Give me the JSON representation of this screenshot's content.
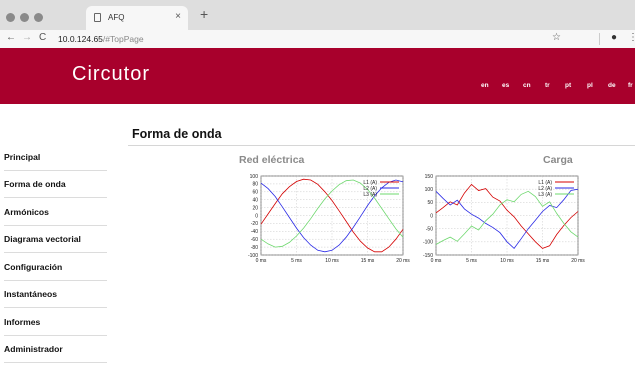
{
  "browser": {
    "tab_title": "AFQ",
    "url_host": "10.0.124.65",
    "url_path": "/#TopPage"
  },
  "header": {
    "logo": "Circutor",
    "languages": [
      "en",
      "es",
      "cn",
      "tr",
      "pt",
      "pl",
      "de",
      "fr"
    ]
  },
  "page": {
    "title": "Forma de onda"
  },
  "sidebar": {
    "items": [
      {
        "label": "Principal"
      },
      {
        "label": "Forma de onda"
      },
      {
        "label": "Armónicos"
      },
      {
        "label": "Diagrama vectorial"
      },
      {
        "label": "Configuración"
      },
      {
        "label": "Instantáneos"
      },
      {
        "label": "Informes"
      },
      {
        "label": "Administrador"
      }
    ]
  },
  "sections": {
    "left_title": "Red eléctrica",
    "right_title": "Carga"
  },
  "colors": {
    "header": "#a8002c",
    "L1": "#d40000",
    "L2": "#2a2ae6",
    "L3": "#6ed86e"
  },
  "chart_data": [
    {
      "type": "line",
      "title": "Red eléctrica",
      "xlabel": "",
      "ylabel": "",
      "xlim": [
        0,
        20
      ],
      "ylim": [
        -100,
        100
      ],
      "x_ticks": [
        "0 ms",
        "5 ms",
        "10 ms",
        "15 ms",
        "20 ms"
      ],
      "y_ticks": [
        "100",
        "80",
        "60",
        "40",
        "20",
        "0",
        "-20",
        "-40",
        "-60",
        "-80",
        "-100"
      ],
      "grid": true,
      "legend": "top-right",
      "x": [
        0,
        1,
        2,
        3,
        4,
        5,
        6,
        7,
        8,
        9,
        10,
        11,
        12,
        13,
        14,
        15,
        16,
        17,
        18,
        19,
        20
      ],
      "series": [
        {
          "name": "L1 (A)",
          "values": [
            -22,
            4,
            30,
            55,
            73,
            86,
            92,
            90,
            79,
            60,
            38,
            12,
            -15,
            -42,
            -65,
            -82,
            -92,
            -92,
            -80,
            -60,
            -35
          ]
        },
        {
          "name": "L2 (A)",
          "values": [
            82,
            68,
            48,
            22,
            -5,
            -32,
            -56,
            -75,
            -88,
            -92,
            -88,
            -75,
            -55,
            -30,
            -3,
            25,
            50,
            70,
            84,
            90,
            85
          ]
        },
        {
          "name": "L3 (A)",
          "values": [
            -60,
            -72,
            -80,
            -78,
            -68,
            -52,
            -32,
            -8,
            18,
            42,
            62,
            78,
            88,
            90,
            82,
            66,
            44,
            18,
            -8,
            -34,
            -55
          ]
        }
      ]
    },
    {
      "type": "line",
      "title": "Carga",
      "xlabel": "",
      "ylabel": "",
      "xlim": [
        0,
        20
      ],
      "ylim": [
        -150,
        150
      ],
      "x_ticks": [
        "0 ms",
        "5 ms",
        "10 ms",
        "15 ms",
        "20 ms"
      ],
      "y_ticks": [
        "150",
        "100",
        "50",
        "0",
        "-50",
        "-100",
        "-150"
      ],
      "grid": true,
      "legend": "top-right",
      "x": [
        0,
        1,
        2,
        3,
        4,
        5,
        6,
        7,
        8,
        9,
        10,
        11,
        12,
        13,
        14,
        15,
        16,
        17,
        18,
        19,
        20
      ],
      "series": [
        {
          "name": "L1 (A)",
          "values": [
            10,
            30,
            52,
            40,
            85,
            118,
            95,
            102,
            70,
            55,
            20,
            -5,
            -40,
            -70,
            -100,
            -125,
            -115,
            -72,
            -38,
            -8,
            15
          ]
        },
        {
          "name": "L2 (A)",
          "values": [
            92,
            65,
            40,
            58,
            25,
            5,
            -10,
            -30,
            -45,
            -65,
            -100,
            -125,
            -88,
            -50,
            -18,
            15,
            38,
            30,
            60,
            95,
            100
          ]
        },
        {
          "name": "L3 (A)",
          "values": [
            -110,
            -95,
            -82,
            -98,
            -70,
            -40,
            -55,
            -20,
            5,
            40,
            60,
            52,
            80,
            92,
            72,
            35,
            52,
            8,
            -30,
            -62,
            -82
          ]
        }
      ]
    }
  ]
}
